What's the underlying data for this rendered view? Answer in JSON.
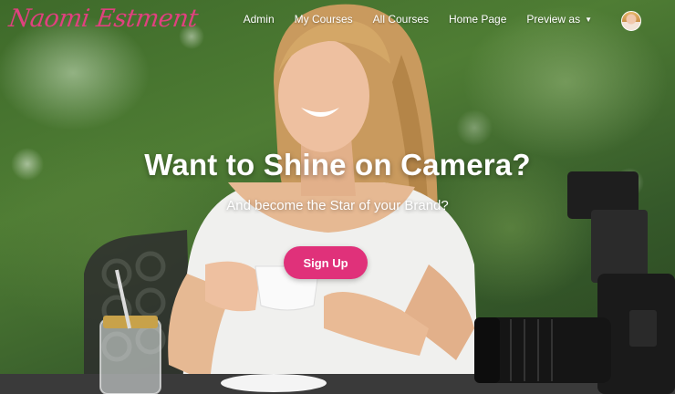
{
  "brand": {
    "logo_text": "Naomi Estment",
    "accent_color": "#e0317a"
  },
  "nav": {
    "items": [
      {
        "label": "Admin"
      },
      {
        "label": "My Courses"
      },
      {
        "label": "All Courses"
      },
      {
        "label": "Home Page"
      },
      {
        "label": "Preview as",
        "has_dropdown": true
      }
    ],
    "avatar_icon": "user-avatar"
  },
  "hero": {
    "headline": "Want to Shine on Camera?",
    "subheadline": "And become the Star of your Brand?",
    "cta_label": "Sign Up"
  }
}
